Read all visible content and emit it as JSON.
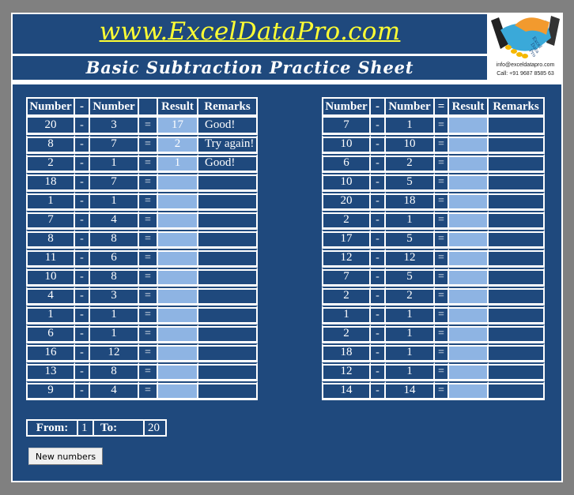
{
  "header": {
    "site_url": "www.ExcelDataPro.com",
    "title": "Basic Subtraction Practice Sheet",
    "logo": {
      "icon": "handshake-logo-icon",
      "email": "info@exceldatapro.com",
      "phone": "Call: +91 9687 8585 63"
    }
  },
  "colors": {
    "panel_bg": "#1f497d",
    "result_cell": "#8eb4e3",
    "url_text": "#ffff33",
    "page_bg": "#808080"
  },
  "left_table": {
    "headers": [
      "Number",
      "-",
      "Number",
      "",
      "Result",
      "Remarks"
    ],
    "rows": [
      {
        "a": "20",
        "op": "-",
        "b": "3",
        "eq": "=",
        "result": "17",
        "remark": "Good!"
      },
      {
        "a": "8",
        "op": "-",
        "b": "7",
        "eq": "=",
        "result": "2",
        "remark": "Try again!"
      },
      {
        "a": "2",
        "op": "-",
        "b": "1",
        "eq": "=",
        "result": "1",
        "remark": "Good!"
      },
      {
        "a": "18",
        "op": "-",
        "b": "7",
        "eq": "=",
        "result": "",
        "remark": ""
      },
      {
        "a": "1",
        "op": "-",
        "b": "1",
        "eq": "=",
        "result": "",
        "remark": ""
      },
      {
        "a": "7",
        "op": "-",
        "b": "4",
        "eq": "=",
        "result": "",
        "remark": ""
      },
      {
        "a": "8",
        "op": "-",
        "b": "8",
        "eq": "=",
        "result": "",
        "remark": ""
      },
      {
        "a": "11",
        "op": "-",
        "b": "6",
        "eq": "=",
        "result": "",
        "remark": ""
      },
      {
        "a": "10",
        "op": "-",
        "b": "8",
        "eq": "=",
        "result": "",
        "remark": ""
      },
      {
        "a": "4",
        "op": "-",
        "b": "3",
        "eq": "=",
        "result": "",
        "remark": ""
      },
      {
        "a": "1",
        "op": "-",
        "b": "1",
        "eq": "=",
        "result": "",
        "remark": ""
      },
      {
        "a": "6",
        "op": "-",
        "b": "1",
        "eq": "=",
        "result": "",
        "remark": ""
      },
      {
        "a": "16",
        "op": "-",
        "b": "12",
        "eq": "=",
        "result": "",
        "remark": ""
      },
      {
        "a": "13",
        "op": "-",
        "b": "8",
        "eq": "=",
        "result": "",
        "remark": ""
      },
      {
        "a": "9",
        "op": "-",
        "b": "4",
        "eq": "=",
        "result": "",
        "remark": ""
      }
    ]
  },
  "right_table": {
    "headers": [
      "Number",
      "-",
      "Number",
      "=",
      "Result",
      "Remarks"
    ],
    "rows": [
      {
        "a": "7",
        "op": "-",
        "b": "1",
        "eq": "=",
        "result": "",
        "remark": ""
      },
      {
        "a": "10",
        "op": "-",
        "b": "10",
        "eq": "=",
        "result": "",
        "remark": ""
      },
      {
        "a": "6",
        "op": "-",
        "b": "2",
        "eq": "=",
        "result": "",
        "remark": ""
      },
      {
        "a": "10",
        "op": "-",
        "b": "5",
        "eq": "=",
        "result": "",
        "remark": ""
      },
      {
        "a": "20",
        "op": "-",
        "b": "18",
        "eq": "=",
        "result": "",
        "remark": ""
      },
      {
        "a": "2",
        "op": "-",
        "b": "1",
        "eq": "=",
        "result": "",
        "remark": ""
      },
      {
        "a": "17",
        "op": "-",
        "b": "5",
        "eq": "=",
        "result": "",
        "remark": ""
      },
      {
        "a": "12",
        "op": "-",
        "b": "12",
        "eq": "=",
        "result": "",
        "remark": ""
      },
      {
        "a": "7",
        "op": "-",
        "b": "5",
        "eq": "=",
        "result": "",
        "remark": ""
      },
      {
        "a": "2",
        "op": "-",
        "b": "2",
        "eq": "=",
        "result": "",
        "remark": ""
      },
      {
        "a": "1",
        "op": "-",
        "b": "1",
        "eq": "=",
        "result": "",
        "remark": ""
      },
      {
        "a": "2",
        "op": "-",
        "b": "1",
        "eq": "=",
        "result": "",
        "remark": ""
      },
      {
        "a": "18",
        "op": "-",
        "b": "1",
        "eq": "=",
        "result": "",
        "remark": ""
      },
      {
        "a": "12",
        "op": "-",
        "b": "1",
        "eq": "=",
        "result": "",
        "remark": ""
      },
      {
        "a": "14",
        "op": "-",
        "b": "14",
        "eq": "=",
        "result": "",
        "remark": ""
      }
    ]
  },
  "range": {
    "from_label": "From:",
    "from_value": "1",
    "to_label": "To:",
    "to_value": "20"
  },
  "buttons": {
    "new_numbers": "New numbers"
  }
}
